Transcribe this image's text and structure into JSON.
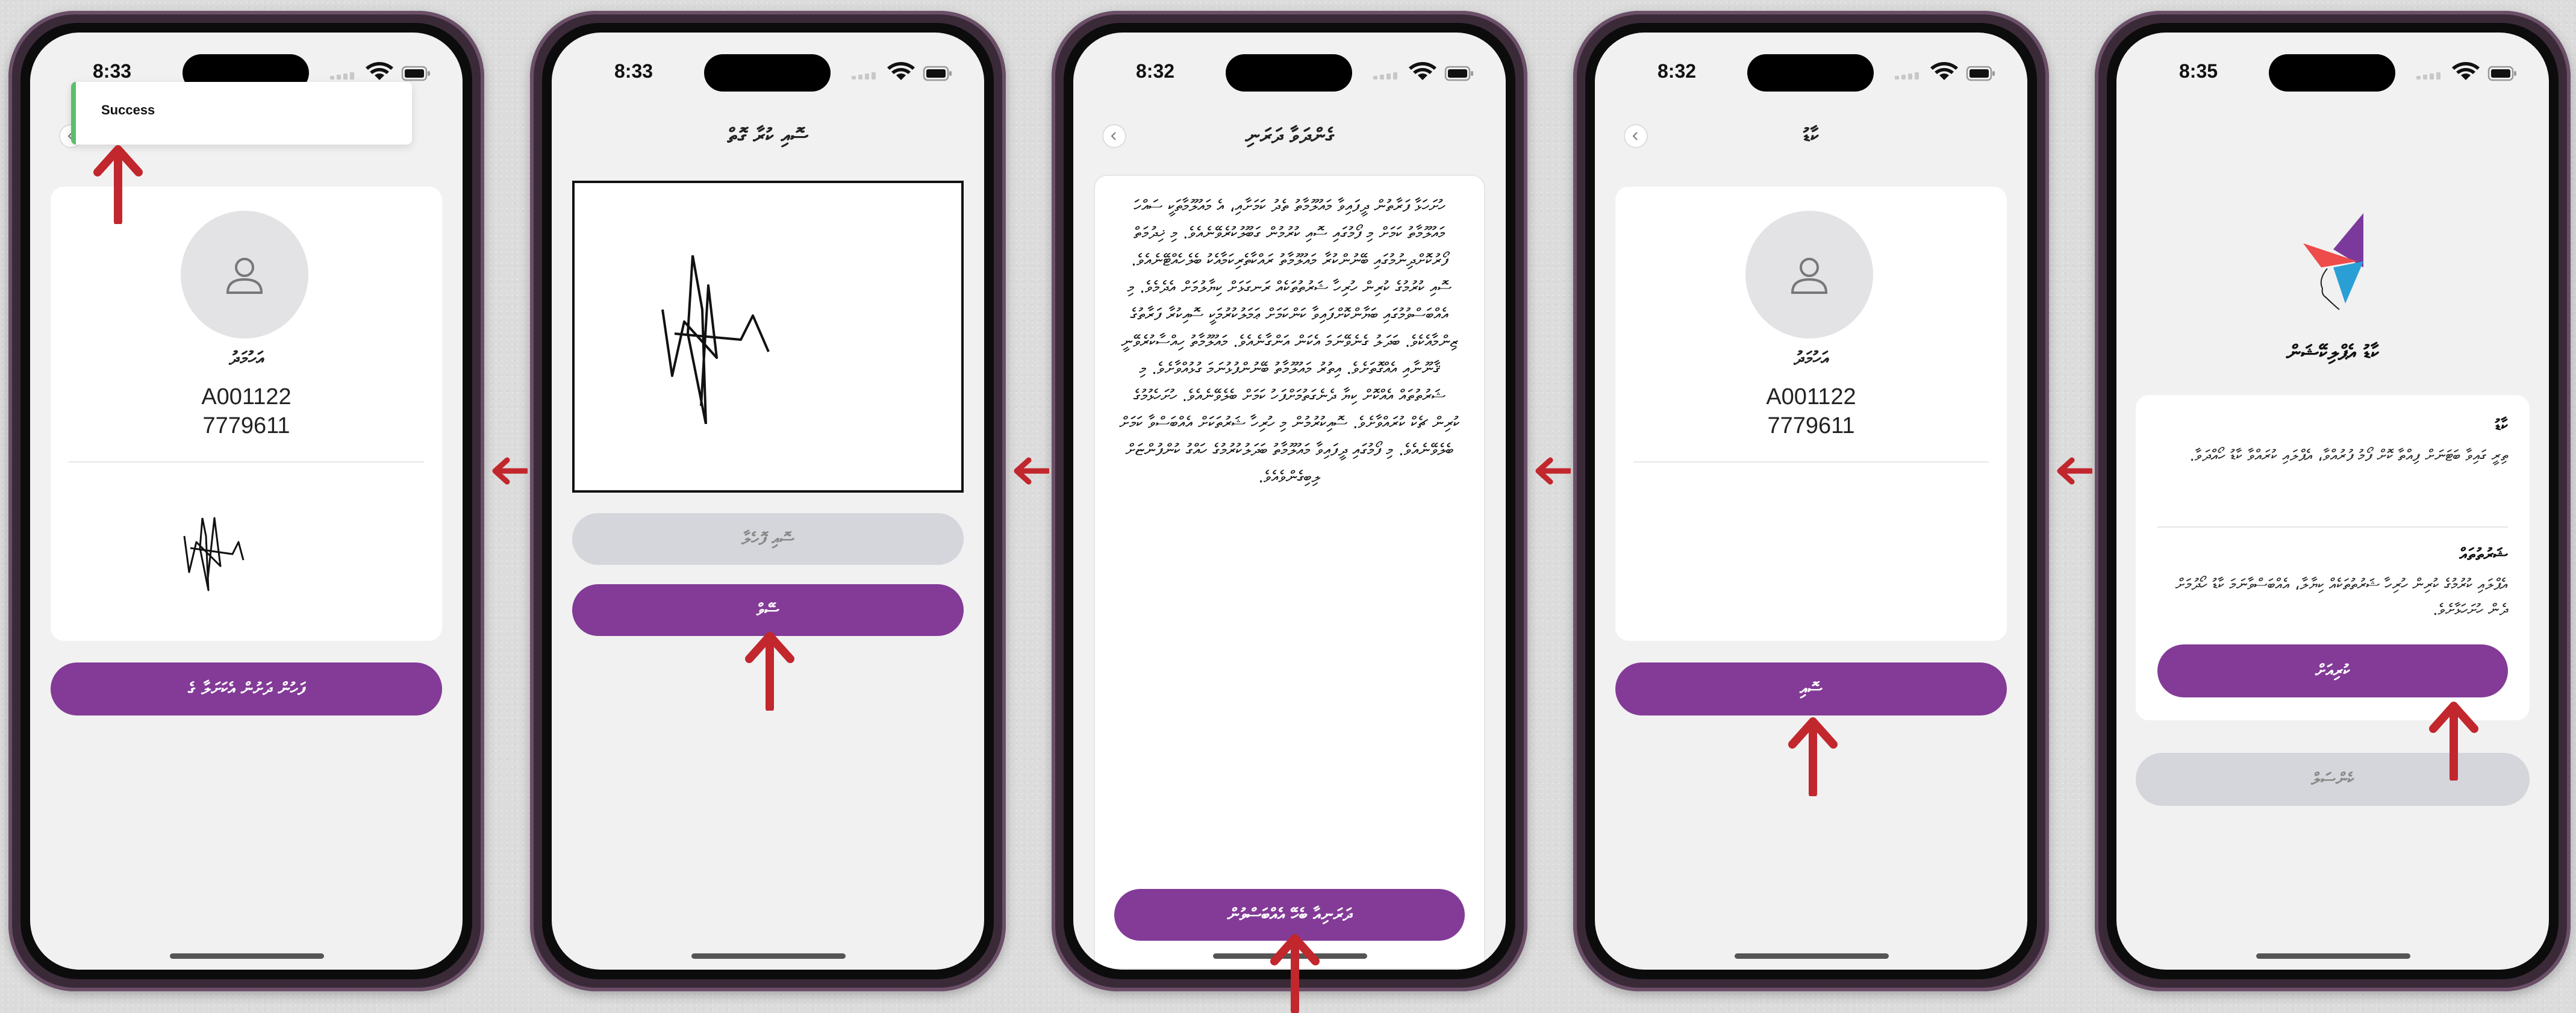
{
  "screens": [
    {
      "time": "8:33",
      "toast": {
        "text": "Success"
      },
      "profile": {
        "name": "އަހުމަދު",
        "id": "A001122",
        "phone": "7779611"
      },
      "primary_button": "ފަހުން ދަށުން އެކަށަލާ ގެ"
    },
    {
      "time": "8:33",
      "title": "ސޮއި ކުރާ ގޮތް",
      "clear_button": "ސޮއި ފޮހެލާ",
      "save_button": "ސޭވް"
    },
    {
      "time": "8:32",
      "title": "ގެންދަވާ ދަރަނި",
      "terms_paragraph": "ހުށަހަޅާ ފަރާތުން ދީފައިވާ މައުލޫމާތު ތެދު ކަމަށާއި، އެ މައުލޫމާތަކީ ސައްހަ މައުލޫމާތު ކަމަށް މި ފޯމުގައި ސޮއި ކުރުމުން ގަބޫލުކުރެވޭނެއެވެ. މި ޚިދުމަތް ފޯރުކޮށްދިނުމުގައި ބޭނުންކުރާ މައުލޫމާތު ރައްކާތެރިކަމާއެކު ބެލެހެއްޓޭނެއެވެ. ސޮއި ކުރުމުގެ ކުރިން ހުރިހާ ޝަރުތުތަކެއް ރަނގަޅަށް ކިޔާލުމަށް އެދެމެވެ. މި އެއްބަސްވުމުގައި ބަޔާންކޮށްފައިވާ ކަންކަމަށް ޢަމަލުކުރުމަކީ ސޮއިކުރާ ފަރާތުގެ ޒިންމާއެކެވެ. ބަދަލު ގެނެވޭނަމަ އެކަން އަންގާނެއެވެ. މައުލޫމާތު ހިއްސާކުރެވޭނީ ޤާނޫނާއި އެއްގޮތަށެވެ. އިތުރު މައުލޫމާތު ބޭނުންފުޅުނަމަ ގުޅުއްވާށެވެ. މި ޝަރުތުތައް އެއްކޮށް ކިޔާ ދެނެގަތުމަށްފަހު ކަމަށް ބެލެވޭނެއެވެ. ހުށަހެޅުމުގެ ކުރިން ޗެކް ކުރައްވާށެވެ. ސޮއިކުރުމުން މި ހުރިހާ ޝަރުތަކަށް އެއްބަސްވާ ކަމަށް ބެލެވޭނެއެވެ. މި ފޯމުގައި ދީފައިވާ މައުލޫމާތު ބަދަލުކުރުމުގެ ހައްގު ކުންފުންޏަށް ލިބިގެންވެއެވެ.",
      "agree_button": "ދަރަނިއާ ބެހޭ އެއްބަސްވުން"
    },
    {
      "time": "8:32",
      "title": "ކާޑު",
      "profile": {
        "name": "އަހުމަދު",
        "id": "A001122",
        "phone": "7779611"
      },
      "sign_button": "ސޮއި"
    },
    {
      "time": "8:35",
      "title": "ކާޑު އެޕްލިކޭޝަން",
      "section1": {
        "heading": "ކާޑު",
        "body": "ތިރީ ގައިވާ ބަޓަނަށް ފިއްތާ ކޮށް ފޯމު ފުރުއްވާ، އެޕްލައި ކުރައްވާ ކާޑު ހޯއްދަވާ."
      },
      "section2": {
        "heading": "ޝަރުތުތައް",
        "body": "އެޕްލައި ކުރުމުގެ ކުރިން ހުރިހާ ޝަރުތުތަކެއް ކިޔާލާ، އެއްބަސްވާނަމަ ކާޑު ހޯދުމަށް ދެން ހުށަހަޅާށެވެ."
      },
      "next_button": "ކުރިއަށް",
      "cancel_button": "ކެންސަލް"
    }
  ]
}
